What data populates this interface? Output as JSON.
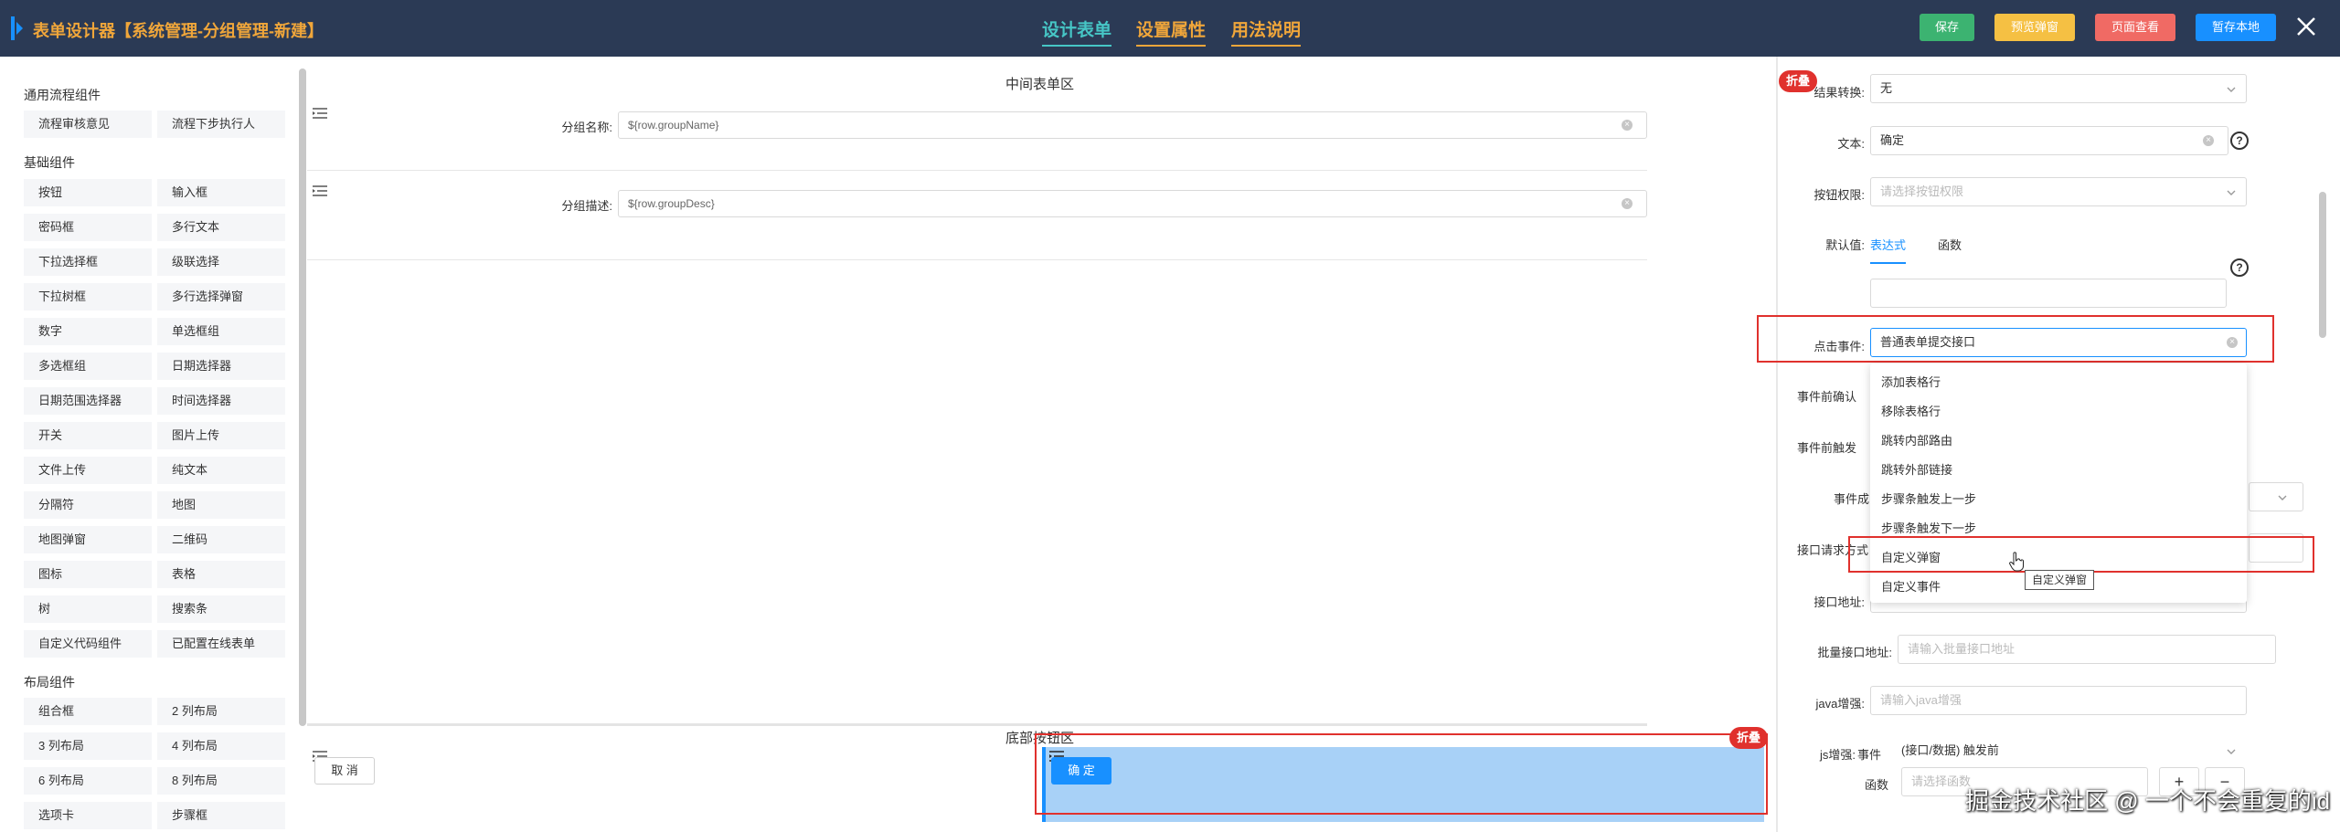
{
  "header": {
    "app_title": "表单设计器【系统管理-分组管理-新建】",
    "nav": [
      "设计表单",
      "设置属性",
      "用法说明"
    ],
    "buttons": {
      "save": "保存",
      "preview": "预览弹窗",
      "page_view": "页面查看",
      "save_local": "暂存本地"
    }
  },
  "left": {
    "sections": [
      {
        "title": "通用流程组件",
        "items": [
          "流程审核意见",
          "流程下步执行人"
        ]
      },
      {
        "title": "基础组件",
        "items": [
          "按钮",
          "输入框",
          "密码框",
          "多行文本",
          "下拉选择框",
          "级联选择",
          "下拉树框",
          "多行选择弹窗",
          "数字",
          "单选框组",
          "多选框组",
          "日期选择器",
          "日期范围选择器",
          "时间选择器",
          "开关",
          "图片上传",
          "文件上传",
          "纯文本",
          "分隔符",
          "地图",
          "地图弹窗",
          "二维码",
          "图标",
          "表格",
          "树",
          "搜索条",
          "自定义代码组件",
          "已配置在线表单"
        ]
      },
      {
        "title": "布局组件",
        "items": [
          "组合框",
          "2 列布局",
          "3 列布局",
          "4 列布局",
          "6 列布局",
          "8 列布局",
          "选项卡",
          "步骤框"
        ]
      }
    ]
  },
  "canvas": {
    "middle_zone_label": "中间表单区",
    "fields": [
      {
        "label": "分组名称:",
        "value": "${row.groupName}"
      },
      {
        "label": "分组描述:",
        "value": "${row.groupDesc}"
      }
    ],
    "bottom_zone_label": "底部按钮区",
    "cancel_label": "取 消",
    "confirm_label": "确 定",
    "fold_label": "折叠"
  },
  "right": {
    "fold_label": "折叠",
    "result_convert": {
      "label": "结果转换:",
      "value": "无"
    },
    "text": {
      "label": "文本:",
      "value": "确定"
    },
    "button_perm": {
      "label": "按钮权限:",
      "placeholder": "请选择按钮权限"
    },
    "default_value": {
      "label": "默认值:",
      "tabs": [
        "表达式",
        "函数"
      ]
    },
    "click_event": {
      "label": "点击事件:",
      "value": "普通表单提交接口"
    },
    "event_confirm": {
      "label": "事件前确认"
    },
    "event_before_trigger": {
      "label": "事件前触发"
    },
    "event_success": {
      "label": "事件成"
    },
    "api_request": {
      "label": "接口请求方式"
    },
    "api_address": {
      "label": "接口地址:"
    },
    "batch_api": {
      "label": "批量接口地址:",
      "placeholder": "请输入批量接口地址"
    },
    "java_enhance": {
      "label": "java增强:",
      "placeholder": "请输入java增强"
    },
    "js_enhance": {
      "label": "js增强:",
      "event_label": "事件",
      "event_value": "(接口/数据) 触发前",
      "func_label": "函数",
      "func_placeholder": "请选择函数"
    },
    "plus": "+",
    "minus": "−",
    "dropdown": [
      "添加表格行",
      "移除表格行",
      "跳转内部路由",
      "跳转外部链接",
      "步骤条触发上一步",
      "步骤条触发下一步",
      "自定义弹窗",
      "自定义事件"
    ],
    "tooltip": "自定义弹窗"
  },
  "watermark": "掘金技术社区 @ 一个不会重复的id",
  "colors": {
    "topbar": "#2b3a55",
    "accent_orange": "#f0a63a",
    "accent_teal": "#46c6c6",
    "save_green": "#3cb371",
    "preview_yellow": "#f5c043",
    "page_red": "#f06a64",
    "local_blue": "#1890ff",
    "highlight_red": "#e0312d"
  }
}
